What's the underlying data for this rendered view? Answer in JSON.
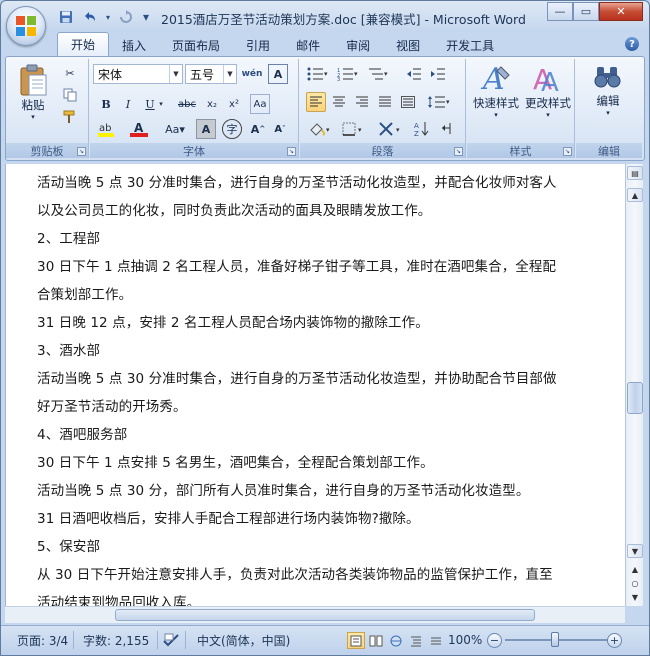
{
  "window": {
    "title": "2015酒店万圣节活动策划方案.doc [兼容模式] - Microsoft Word",
    "controls": {
      "minimize": "—",
      "restore": "▭",
      "close": "✕"
    }
  },
  "quick_access": {
    "save_icon": "save-icon",
    "undo_icon": "undo-icon",
    "redo_icon": "redo-icon",
    "customize": "▾"
  },
  "tabs": [
    "开始",
    "插入",
    "页面布局",
    "引用",
    "邮件",
    "审阅",
    "视图",
    "开发工具"
  ],
  "active_tab": "开始",
  "ribbon": {
    "clipboard": {
      "label": "剪贴板",
      "paste": "粘贴"
    },
    "font": {
      "label": "字体",
      "font_name": "宋体",
      "font_size": "五号"
    },
    "paragraph": {
      "label": "段落"
    },
    "styles": {
      "label": "样式",
      "quick_styles": "快速样式",
      "change_styles": "更改样式"
    },
    "editing": {
      "label": "编辑",
      "edit": "编辑"
    }
  },
  "document": {
    "lines": [
      "活动当晚 5 点 30 分准时集合，进行自身的万圣节活动化妆造型，并配合化妆师对客人",
      "以及公司员工的化妆，同时负责此次活动的面具及眼睛发放工作。",
      "2、工程部",
      "30 日下午 1 点抽调 2 名工程人员，准备好梯子钳子等工具，准时在酒吧集合，全程配",
      "合策划部工作。",
      "31 日晚 12 点，安排 2 名工程人员配合场内装饰物的撤除工作。",
      "3、酒水部",
      "活动当晚 5 点 30 分准时集合，进行自身的万圣节活动化妆造型，并协助配合节目部做",
      "好万圣节活动的开场秀。",
      "4、酒吧服务部",
      "30 日下午 1 点安排 5 名男生，酒吧集合，全程配合策划部工作。",
      "活动当晚 5 点 30 分，部门所有人员准时集合，进行自身的万圣节活动化妆造型。",
      "31 日酒吧收档后，安排人手配合工程部进行场内装饰物?撤除。",
      "5、保安部",
      "从 30 日下午开始注意安排人手，负责对此次活动各类装饰物品的监管保护工作，直至",
      "活动结束到物品回收入库。"
    ]
  },
  "status": {
    "page": "页面: 3/4",
    "words": "字数: 2,155",
    "language": "中文(简体，中国)",
    "zoom": "100%",
    "zoom_percent": 100
  }
}
